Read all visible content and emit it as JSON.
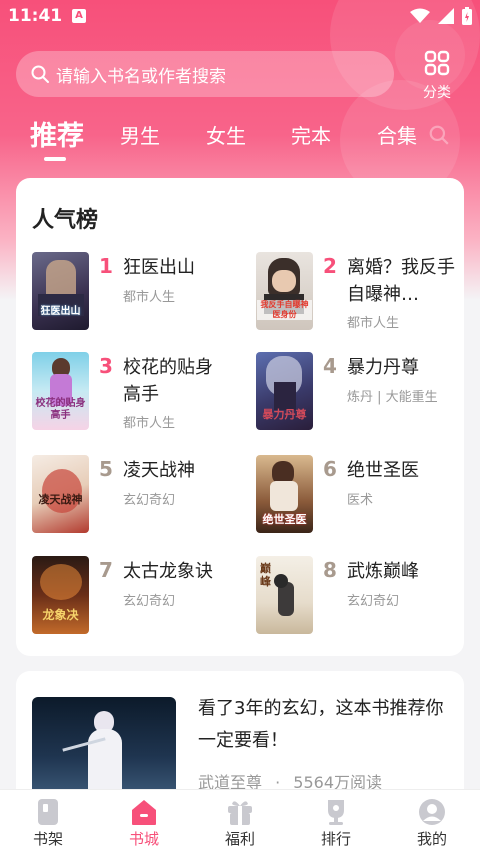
{
  "status": {
    "time": "11:41",
    "notification_badge": "A"
  },
  "search": {
    "placeholder": "请输入书名或作者搜索"
  },
  "category": {
    "label": "分类"
  },
  "tabs": [
    {
      "label": "推荐",
      "active": true
    },
    {
      "label": "男生",
      "active": false
    },
    {
      "label": "女生",
      "active": false
    },
    {
      "label": "完本",
      "active": false
    },
    {
      "label": "合集",
      "active": false
    }
  ],
  "ranking": {
    "title": "人气榜",
    "items": [
      {
        "rank": "1",
        "title": "狂医出山",
        "tag": "都市人生",
        "cover_text": "狂医出山",
        "rank_color": "#f7507a"
      },
      {
        "rank": "2",
        "title": "离婚？我反手自曝神…",
        "tag": "都市人生",
        "cover_text": "我反手自曝神医身份",
        "rank_color": "#f7507a"
      },
      {
        "rank": "3",
        "title": "校花的贴身高手",
        "tag": "都市人生",
        "cover_text": "校花的贴身高手",
        "rank_color": "#f7507a"
      },
      {
        "rank": "4",
        "title": "暴力丹尊",
        "tag": "炼丹 | 大能重生",
        "cover_text": "暴力丹尊",
        "rank_color": "#a89a8e"
      },
      {
        "rank": "5",
        "title": "凌天战神",
        "tag": "玄幻奇幻",
        "cover_text": "凌天战神",
        "rank_color": "#a89a8e"
      },
      {
        "rank": "6",
        "title": "绝世圣医",
        "tag": "医术",
        "cover_text": "绝世圣医",
        "rank_color": "#a89a8e"
      },
      {
        "rank": "7",
        "title": "太古龙象诀",
        "tag": "玄幻奇幻",
        "cover_text": "龙象决",
        "rank_color": "#a89a8e"
      },
      {
        "rank": "8",
        "title": "武炼巅峰",
        "tag": "玄幻奇幻",
        "cover_text": "巅峰",
        "rank_color": "#a89a8e"
      }
    ]
  },
  "promo": {
    "text": "看了3年的玄幻，这本书推荐你一定要看！",
    "book": "武道至尊",
    "separator": "·",
    "reads": "5564万阅读"
  },
  "bottom_nav": [
    {
      "label": "书架",
      "icon": "bookshelf-icon",
      "active": false
    },
    {
      "label": "书城",
      "icon": "bookstore-icon",
      "active": true
    },
    {
      "label": "福利",
      "icon": "gift-icon",
      "active": false
    },
    {
      "label": "排行",
      "icon": "trophy-icon",
      "active": false
    },
    {
      "label": "我的",
      "icon": "profile-icon",
      "active": false
    }
  ],
  "colors": {
    "accent": "#f7507a",
    "rank_top": "#f7507a",
    "rank_other": "#a89a8e"
  }
}
